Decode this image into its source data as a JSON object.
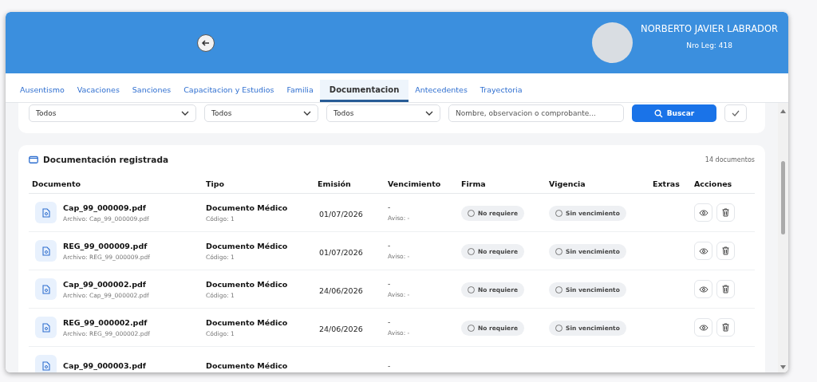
{
  "header": {
    "name": "NORBERTO JAVIER LABRADOR",
    "legajo": "Nro Leg: 418"
  },
  "tabs": [
    {
      "label": "Ausentismo",
      "selected": false
    },
    {
      "label": "Vacaciones",
      "selected": false
    },
    {
      "label": "Sanciones",
      "selected": false
    },
    {
      "label": "Capacitacion y Estudios",
      "selected": false
    },
    {
      "label": "Familia",
      "selected": false
    },
    {
      "label": "Documentacion",
      "selected": true
    },
    {
      "label": "Antecedentes",
      "selected": false
    },
    {
      "label": "Trayectoria",
      "selected": false
    }
  ],
  "filters": {
    "selects": [
      "Todos",
      "Todos",
      "Todos"
    ],
    "search_placeholder": "Nombre, observacion o comprobante...",
    "search_button": "Buscar"
  },
  "documents": {
    "title": "Documentación registrada",
    "count": "14 documentos",
    "columns": [
      "Documento",
      "Tipo",
      "Emisión",
      "Vencimiento",
      "Firma",
      "Vigencia",
      "Extras",
      "Acciones"
    ],
    "rows": [
      {
        "name": "Cap_99_000009.pdf",
        "file": "Archivo: Cap_99_000009.pdf",
        "type": "Documento Médico",
        "code": "Código: 1",
        "issued": "01/07/2026",
        "expiry": "-",
        "notice": "Aviso: -",
        "signature": "No requiere",
        "validity": "Sin vencimiento"
      },
      {
        "name": "REG_99_000009.pdf",
        "file": "Archivo: REG_99_000009.pdf",
        "type": "Documento Médico",
        "code": "Código: 1",
        "issued": "01/07/2026",
        "expiry": "-",
        "notice": "Aviso: -",
        "signature": "No requiere",
        "validity": "Sin vencimiento"
      },
      {
        "name": "Cap_99_000002.pdf",
        "file": "Archivo: Cap_99_000002.pdf",
        "type": "Documento Médico",
        "code": "Código: 1",
        "issued": "24/06/2026",
        "expiry": "-",
        "notice": "Aviso: -",
        "signature": "No requiere",
        "validity": "Sin vencimiento"
      },
      {
        "name": "REG_99_000002.pdf",
        "file": "Archivo: REG_99_000002.pdf",
        "type": "Documento Médico",
        "code": "Código: 1",
        "issued": "24/06/2026",
        "expiry": "-",
        "notice": "Aviso: -",
        "signature": "No requiere",
        "validity": "Sin vencimiento"
      },
      {
        "name": "Cap_99_000003.pdf",
        "type": "Documento Médico",
        "expiry": "-"
      }
    ]
  }
}
